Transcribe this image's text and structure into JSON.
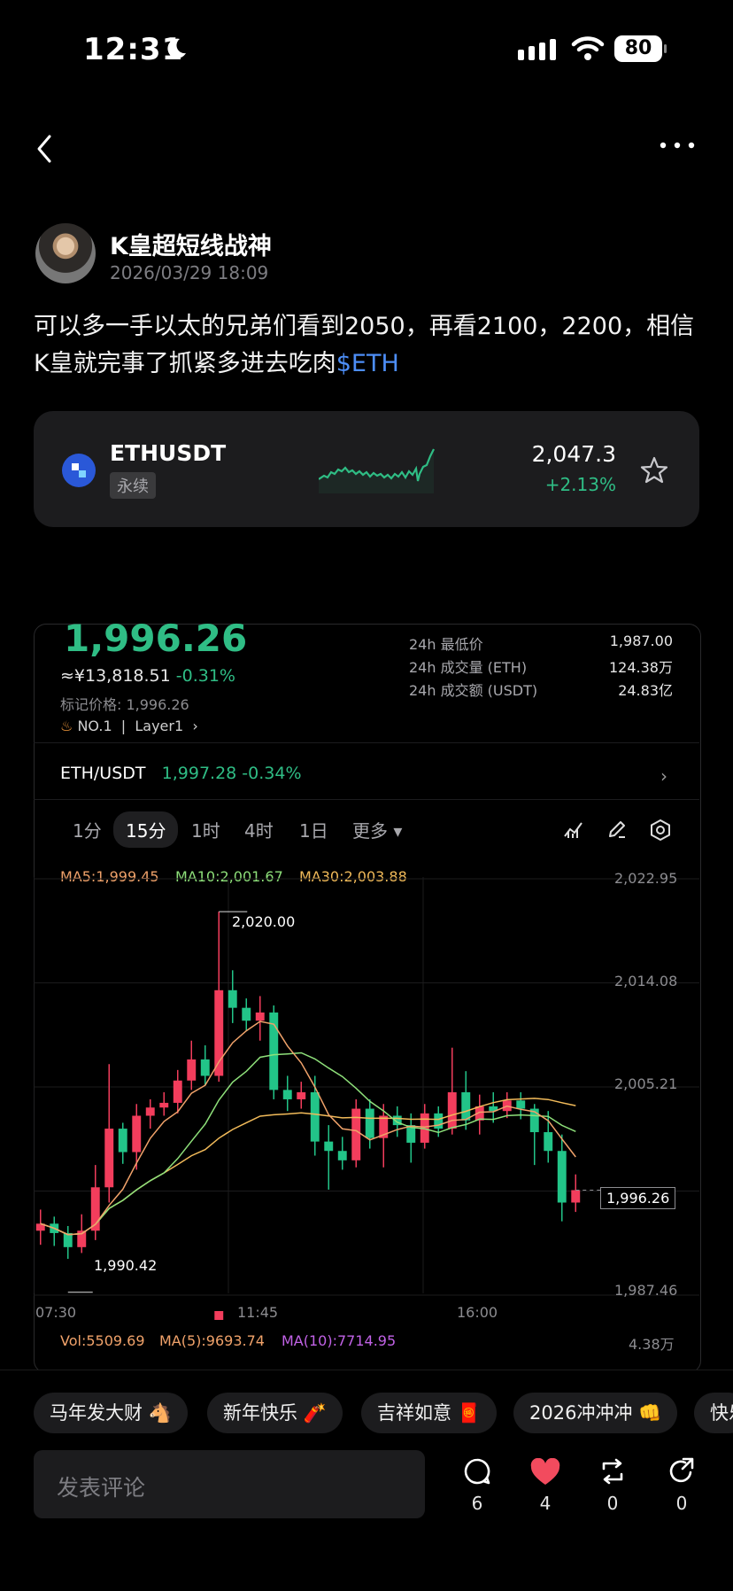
{
  "status_bar": {
    "time": "12:31",
    "battery": "80"
  },
  "post": {
    "author": "K皇超短线战神",
    "time": "2026/03/29 18:09",
    "text": "可以多一手以太的兄弟们看到2050，再看2100，2200，相信K皇就完事了抓紧多进去吃肉",
    "ticker": "$ETH"
  },
  "ticker_card": {
    "symbol": "ETHUSDT",
    "tag": "永续",
    "price": "2,047.3",
    "change": "+2.13%",
    "icon": "exchange-logo-icon"
  },
  "chart_screenshot": {
    "price": "1,996.26",
    "cny": "≈¥13,818.51",
    "cny_change": "-0.31%",
    "mark_price": "标记价格: 1,996.26",
    "rank": "NO.1",
    "sector": "Layer1",
    "stats": [
      {
        "label": "24h 最低价",
        "value": "1,987.00"
      },
      {
        "label": "24h 成交量 (ETH)",
        "value": "124.38万"
      },
      {
        "label": "24h 成交额 (USDT)",
        "value": "24.83亿"
      }
    ],
    "pair": "ETH/USDT",
    "pair_price": "1,997.28",
    "pair_change": "-0.34%",
    "timeframes": [
      "1分",
      "15分",
      "1时",
      "4时",
      "1日",
      "更多"
    ],
    "active_timeframe": "15分",
    "ma": {
      "ma5": "MA5:1,999.45",
      "ma10": "MA10:2,001.67",
      "ma30": "MA30:2,003.88"
    },
    "y_labels": [
      "2,022.95",
      "2,014.08",
      "2,005.21",
      "1,987.46"
    ],
    "x_labels": [
      "07:30",
      "11:45",
      "16:00"
    ],
    "high_label": "2,020.00",
    "low_label": "1,990.42",
    "current_label": "1,996.26",
    "vol": {
      "vol": "Vol:5509.69",
      "ma5": "MA(5):9693.74",
      "ma10": "MA(10):7714.95",
      "right": "4.38万"
    }
  },
  "chart_data": {
    "type": "candlestick",
    "x": [
      "07:30",
      "11:45",
      "16:00"
    ],
    "ylim": [
      1987.46,
      2022.95
    ],
    "candles": [
      [
        1992.8,
        1993.4,
        1991.6,
        1994.6
      ],
      [
        1993.4,
        1992.6,
        1991.5,
        1994.0
      ],
      [
        1992.6,
        1991.4,
        1990.4,
        1993.2
      ],
      [
        1991.4,
        1992.8,
        1990.9,
        1994.2
      ],
      [
        1992.8,
        1996.5,
        1992.0,
        1998.4
      ],
      [
        1996.5,
        2001.5,
        1995.2,
        2007.0
      ],
      [
        2001.5,
        1999.5,
        1998.5,
        2002.0
      ],
      [
        1999.5,
        2002.6,
        1998.0,
        2003.6
      ],
      [
        2002.6,
        2003.3,
        2001.5,
        2004.0
      ],
      [
        2003.3,
        2003.7,
        2002.6,
        2004.6
      ],
      [
        2003.7,
        2005.6,
        2002.8,
        2006.5
      ],
      [
        2005.6,
        2007.4,
        2004.8,
        2009.0
      ],
      [
        2007.4,
        2006.0,
        2005.2,
        2008.6
      ],
      [
        2006.0,
        2013.3,
        2005.5,
        2020.0
      ],
      [
        2013.3,
        2011.8,
        2010.5,
        2015.0
      ],
      [
        2011.8,
        2010.7,
        2009.8,
        2012.6
      ],
      [
        2010.7,
        2011.4,
        2009.0,
        2012.8
      ],
      [
        2011.4,
        2004.8,
        2004.0,
        2012.0
      ],
      [
        2004.8,
        2004.0,
        2003.0,
        2006.0
      ],
      [
        2004.0,
        2004.6,
        2003.2,
        2005.5
      ],
      [
        2004.6,
        2000.4,
        1999.2,
        2006.0
      ],
      [
        2000.4,
        1999.6,
        1996.3,
        2001.8
      ],
      [
        1999.6,
        1998.8,
        1998.0,
        2000.8
      ],
      [
        1998.8,
        2003.2,
        1998.2,
        2004.0
      ],
      [
        2003.2,
        2000.7,
        1999.8,
        2004.0
      ],
      [
        2000.7,
        2002.6,
        1998.2,
        2003.6
      ],
      [
        2002.6,
        2001.8,
        2000.8,
        2003.4
      ],
      [
        2001.8,
        2000.3,
        1998.6,
        2002.8
      ],
      [
        2000.3,
        2002.8,
        1999.8,
        2003.6
      ],
      [
        2002.8,
        2001.5,
        2000.8,
        2003.4
      ],
      [
        2001.5,
        2004.6,
        2001.0,
        2008.4
      ],
      [
        2004.6,
        2002.2,
        2001.4,
        2006.4
      ],
      [
        2002.2,
        2003.4,
        2001.0,
        2004.4
      ],
      [
        2003.4,
        2003.0,
        2002.0,
        2004.6
      ],
      [
        2003.0,
        2003.9,
        2002.4,
        2004.6
      ],
      [
        2003.9,
        2003.2,
        2002.3,
        2004.6
      ],
      [
        2003.2,
        2001.2,
        1998.4,
        2003.6
      ],
      [
        2001.2,
        1999.6,
        1998.6,
        2003.0
      ],
      [
        1999.6,
        1995.2,
        1993.6,
        2001.0
      ],
      [
        1995.2,
        1996.26,
        1994.4,
        1997.6
      ]
    ]
  },
  "chips": [
    "马年发大财 🐴",
    "新年快乐 🧨",
    "吉祥如意 🧧",
    "2026冲冲冲 👊",
    "快乐"
  ],
  "comment": {
    "placeholder": "发表评论",
    "counts": {
      "comment": "6",
      "like": "4",
      "repost": "0",
      "share": "0"
    }
  }
}
